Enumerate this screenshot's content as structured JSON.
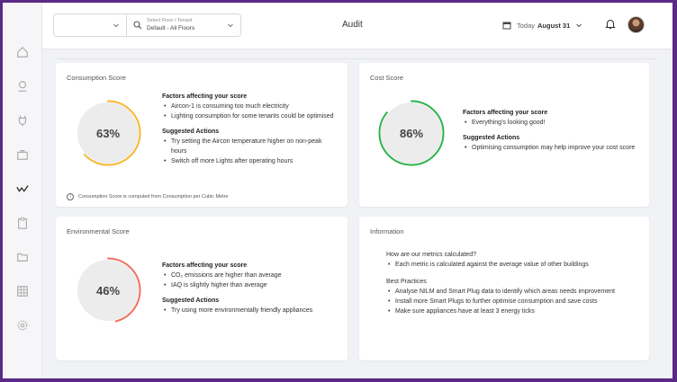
{
  "header": {
    "tenant_label": "Select Floor / Tenant",
    "tenant_value": "Default - All Floors",
    "title": "Audit",
    "date_prefix": "Today",
    "date_value": "August 31"
  },
  "sidebar": {
    "icons": [
      "home-icon",
      "location-icon",
      "plug-icon",
      "briefcase-icon",
      "chart-icon",
      "clipboard-icon",
      "folder-icon",
      "grid-icon",
      "settings-icon"
    ]
  },
  "consumption": {
    "title": "Consumption Score",
    "score": "63%",
    "score_fraction": 0.63,
    "color": "#f5b82e",
    "factors_heading": "Factors affecting your score",
    "factors": [
      "Aircon-1 is consuming too much electricity",
      "Lighting consumption for some tenants could be optimised"
    ],
    "actions_heading": "Suggested Actions",
    "actions": [
      "Try setting the Aircon temperature higher on non-peak hours",
      "Switch off more Lights after operating hours"
    ],
    "note": "Consumption Score is computed from Consumption per Cubic Metre"
  },
  "cost": {
    "title": "Cost Score",
    "score": "86%",
    "score_fraction": 0.86,
    "color": "#2db34a",
    "factors_heading": "Factors affecting your score",
    "factors": [
      "Everything's looking good!"
    ],
    "actions_heading": "Suggested Actions",
    "actions": [
      "Optimising consumption may help improve your cost score"
    ]
  },
  "environmental": {
    "title": "Environmental Score",
    "score": "46%",
    "score_fraction": 0.46,
    "color": "#f07060",
    "factors_heading": "Factors affecting your score",
    "factors": [
      "CO₂ emissions are higher than average",
      "IAQ is slightly higher than average"
    ],
    "actions_heading": "Suggested Actions",
    "actions": [
      "Try using more environmentally friendly appliances"
    ]
  },
  "information": {
    "title": "Information",
    "q_heading": "How are our metrics calculated?",
    "q_items": [
      "Each metric is calculated against the average value of other buildings"
    ],
    "bp_heading": "Best Practices",
    "bp_items": [
      "Analyse NILM and Smart Plug data to identify which areas needs improvement",
      "Install more Smart Plugs to further optimise consumption and save costs",
      "Make sure appliances have at least 3 energy ticks"
    ]
  }
}
